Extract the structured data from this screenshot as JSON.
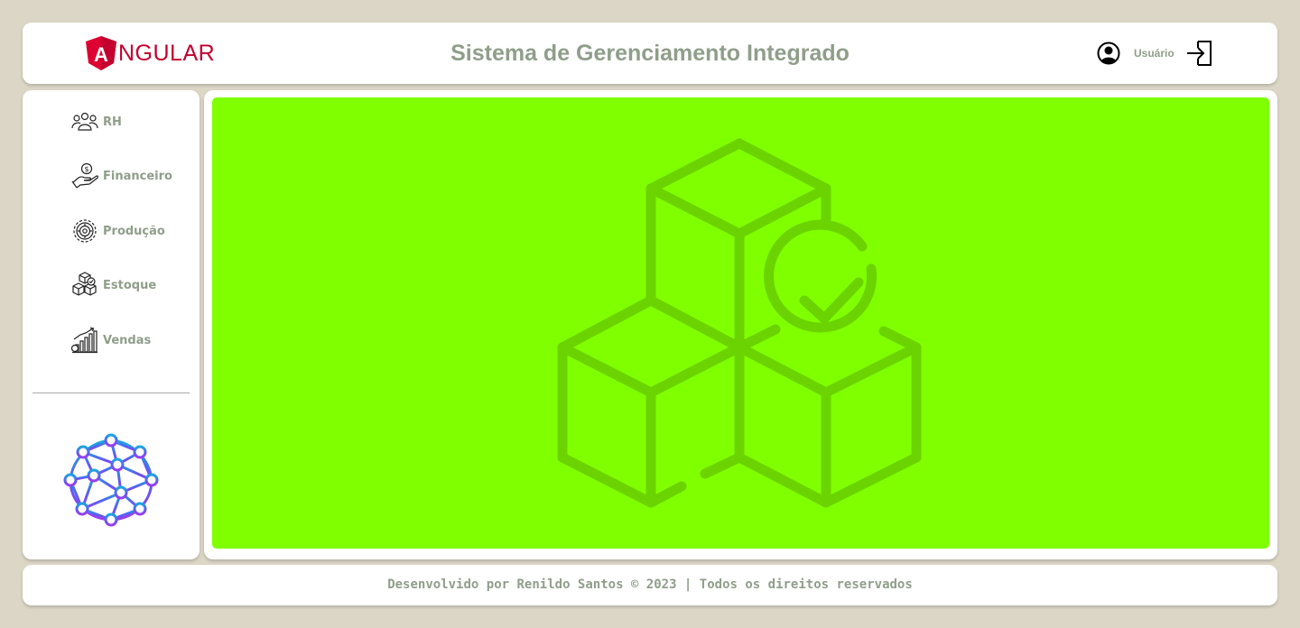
{
  "header": {
    "logo_text": "NGULAR",
    "logo_letter": "A",
    "title": "Sistema de Gerenciamento Integrado",
    "user_label": "Usuário"
  },
  "sidebar": {
    "items": [
      {
        "label": "RH",
        "icon": "people-group-icon"
      },
      {
        "label": "Financeiro",
        "icon": "hand-coin-icon"
      },
      {
        "label": "Produção",
        "icon": "gear-cycle-icon"
      },
      {
        "label": "Estoque",
        "icon": "boxes-check-icon"
      },
      {
        "label": "Vendas",
        "icon": "sales-growth-chart-icon"
      }
    ],
    "logo_icon": "neural-network-globe-icon"
  },
  "main": {
    "background": "#80ff00",
    "art_icon": "stock-boxes-check-icon"
  },
  "footer": {
    "text": "Desenvolvido por Renildo Santos © 2023 | Todos os direitos reservados"
  },
  "colors": {
    "page_bg": "#dcd6c6",
    "panel_bg": "#ffffff",
    "text_muted": "#8f9e8a",
    "brand_red": "#c3002f",
    "accent_green": "#80ff00"
  }
}
